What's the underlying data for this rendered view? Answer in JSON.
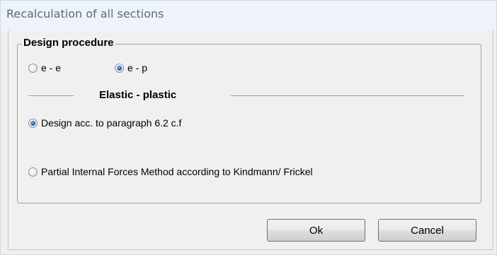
{
  "dialog": {
    "title": "Recalculation of all sections"
  },
  "design_procedure": {
    "legend": "Design procedure",
    "options": [
      {
        "label": "e - e",
        "checked": false
      },
      {
        "label": "e - p",
        "checked": true
      }
    ]
  },
  "elastic_plastic": {
    "heading": "Elastic - plastic",
    "options": [
      {
        "label": "Design acc. to paragraph 6.2 c.f",
        "checked": true
      },
      {
        "label": "Partial Internal Forces Method according to Kindmann/ Frickel",
        "checked": false
      }
    ]
  },
  "buttons": {
    "ok_label": "Ok",
    "cancel_label": "Cancel"
  },
  "colors": {
    "title_text": "#5a6b80",
    "title_bar": "#eef3f9",
    "dialog_bg": "#f0f0f0",
    "radio_selected": "#1a66c2"
  }
}
